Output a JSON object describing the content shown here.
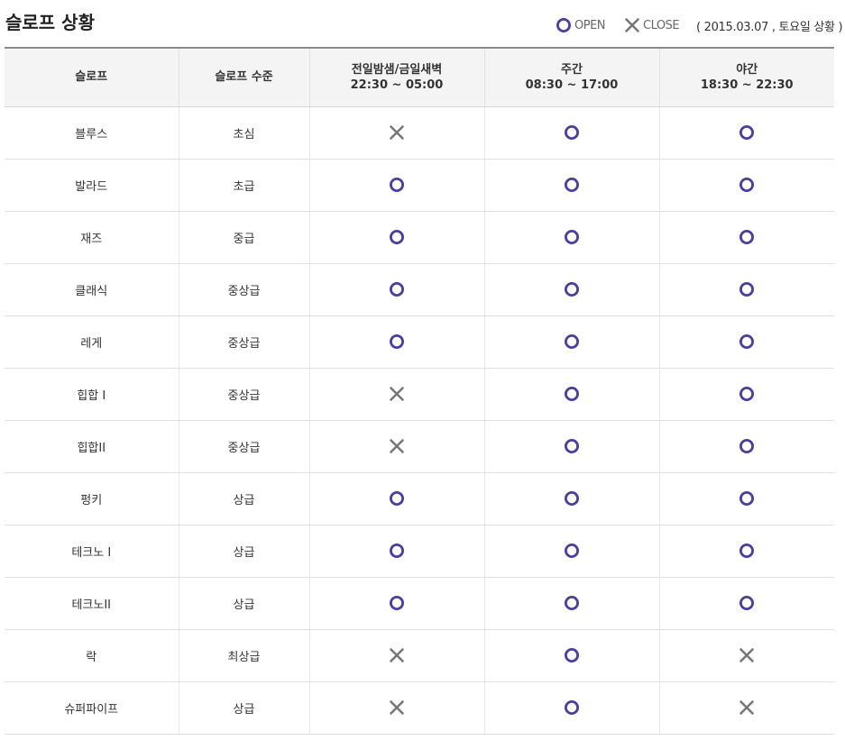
{
  "page": {
    "title": "슬로프 상황",
    "legend": {
      "open_label": "OPEN",
      "close_label": "CLOSE"
    },
    "date_note": "( 2015.03.07 , 토요일 상황 )"
  },
  "colors": {
    "open": "#4b3f9e",
    "close": "#777777"
  },
  "table": {
    "headers": [
      {
        "line1": "슬로프",
        "line2": ""
      },
      {
        "line1": "슬로프 수준",
        "line2": ""
      },
      {
        "line1": "전일밤샘/금일새벽",
        "line2": "22:30 ~ 05:00"
      },
      {
        "line1": "주간",
        "line2": "08:30 ~ 17:00"
      },
      {
        "line1": "야간",
        "line2": "18:30 ~ 22:30"
      }
    ],
    "rows": [
      {
        "slope": "블루스",
        "level": "초심",
        "status": [
          "close",
          "open",
          "open"
        ]
      },
      {
        "slope": "발라드",
        "level": "초급",
        "status": [
          "open",
          "open",
          "open"
        ]
      },
      {
        "slope": "재즈",
        "level": "중급",
        "status": [
          "open",
          "open",
          "open"
        ]
      },
      {
        "slope": "클래식",
        "level": "중상급",
        "status": [
          "open",
          "open",
          "open"
        ]
      },
      {
        "slope": "레게",
        "level": "중상급",
        "status": [
          "open",
          "open",
          "open"
        ]
      },
      {
        "slope": "힙합 I",
        "level": "중상급",
        "status": [
          "close",
          "open",
          "open"
        ]
      },
      {
        "slope": "힙합II",
        "level": "중상급",
        "status": [
          "close",
          "open",
          "open"
        ]
      },
      {
        "slope": "펑키",
        "level": "상급",
        "status": [
          "open",
          "open",
          "open"
        ]
      },
      {
        "slope": "테크노 I",
        "level": "상급",
        "status": [
          "open",
          "open",
          "open"
        ]
      },
      {
        "slope": "테크노II",
        "level": "상급",
        "status": [
          "open",
          "open",
          "open"
        ]
      },
      {
        "slope": "락",
        "level": "최상급",
        "status": [
          "close",
          "open",
          "close"
        ]
      },
      {
        "slope": "슈퍼파이프",
        "level": "상급",
        "status": [
          "close",
          "open",
          "close"
        ]
      }
    ]
  }
}
